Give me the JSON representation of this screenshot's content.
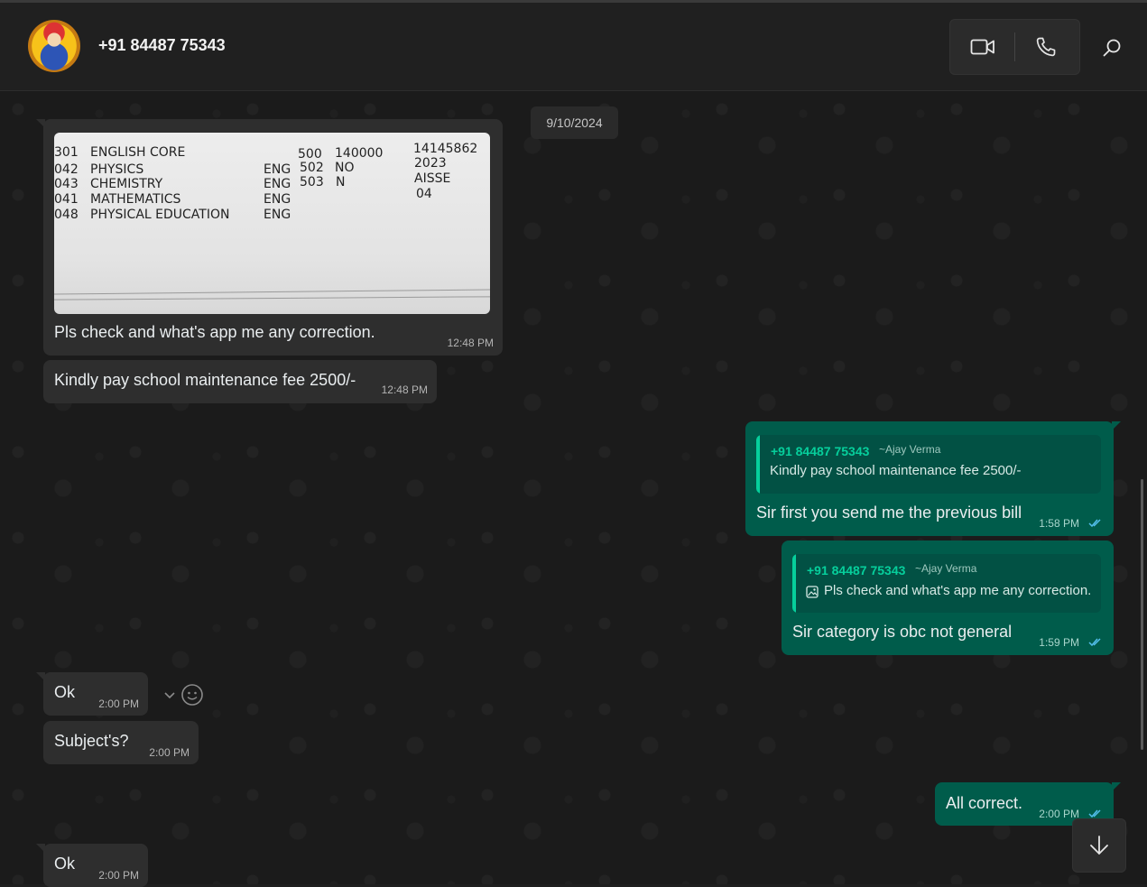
{
  "header": {
    "contact_name": "+91 84487 75343",
    "avatar_icon": "avatar-image",
    "video_icon": "video-camera-icon",
    "call_icon": "phone-icon",
    "search_icon": "search-icon"
  },
  "chat": {
    "date": "9/10/2024",
    "messages": [
      {
        "direction": "incoming",
        "image": {
          "rows": [
            [
              "301",
              "ENGLISH CORE",
              "",
              "500",
              "140000",
              "14145862"
            ],
            [
              "042",
              "PHYSICS",
              "ENG",
              "502",
              "NO",
              "2023"
            ],
            [
              "043",
              "CHEMISTRY",
              "ENG",
              "503",
              "N",
              "AISSE"
            ],
            [
              "041",
              "MATHEMATICS",
              "ENG",
              "",
              "",
              "04"
            ],
            [
              "048",
              "PHYSICAL EDUCATION",
              "ENG",
              "",
              "",
              ""
            ]
          ]
        },
        "text": "Pls check and what's app me any correction.",
        "time": "12:48 PM"
      },
      {
        "direction": "incoming",
        "text": "Kindly pay school maintenance fee 2500/-",
        "time": "12:48 PM"
      },
      {
        "direction": "outgoing",
        "quote": {
          "name": "+91 84487 75343",
          "alias": "~Ajay Verma",
          "text": "Kindly pay school maintenance fee 2500/-"
        },
        "text": "Sir first you send me the previous bill",
        "time": "1:58 PM"
      },
      {
        "direction": "outgoing",
        "quote": {
          "name": "+91 84487 75343",
          "alias": "~Ajay Verma",
          "text": "Pls check and what's app me any correction.",
          "icon": "image-icon"
        },
        "text": "Sir category is obc not general",
        "time": "1:59 PM"
      },
      {
        "direction": "incoming",
        "text": "Ok",
        "time": "2:00 PM"
      },
      {
        "direction": "incoming",
        "text": "Subject's?",
        "time": "2:00 PM"
      },
      {
        "direction": "outgoing",
        "text": "All correct.",
        "time": "2:00 PM"
      },
      {
        "direction": "incoming",
        "text": "Ok",
        "time": "2:00 PM"
      }
    ]
  },
  "colors": {
    "header_bg": "#202020",
    "chat_bg": "#1b1b1b",
    "incoming_bubble": "#2e2e2e",
    "outgoing_bubble": "#005c4b",
    "accent": "#06cf9c",
    "read_ticks": "#53bdeb"
  }
}
